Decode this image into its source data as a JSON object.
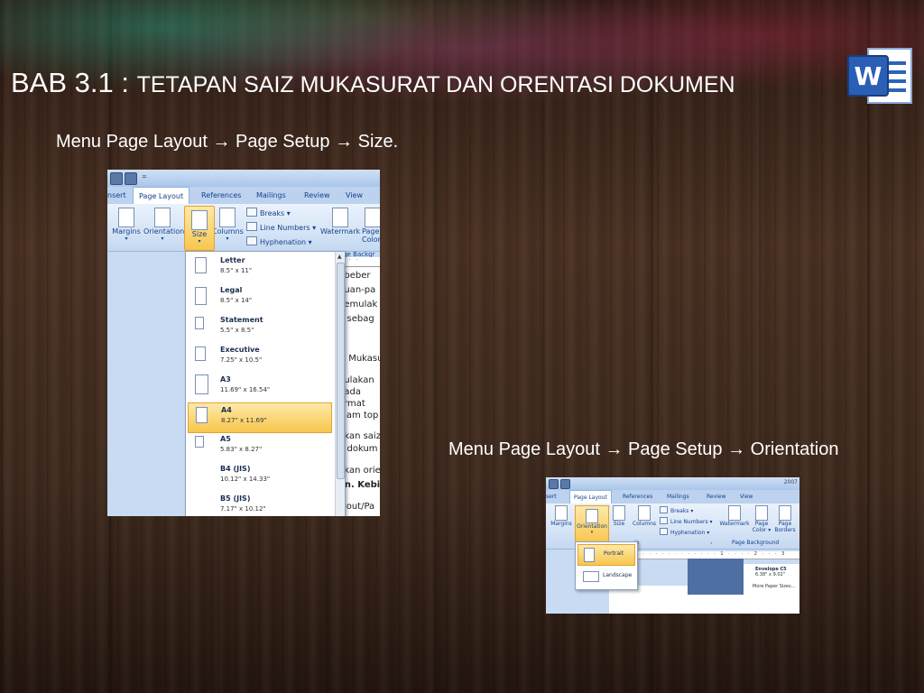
{
  "slide": {
    "title_prefix": "BAB 3.1 : ",
    "title_main": "TETAPAN SAIZ MUKASURAT DAN ORENTASI DOKUMEN",
    "caption1": "Menu Page Layout → Page Setup → Size.",
    "caption2": "Menu Page Layout → Page Setup → Orientation",
    "logo_letter": "W"
  },
  "size_screenshot": {
    "tabs": [
      "nsert",
      "Page Layout",
      "References",
      "Mailings",
      "Review",
      "View"
    ],
    "ribbon": {
      "margins": "Margins",
      "orientation": "Orientation",
      "size": "Size",
      "columns": "Columns",
      "breaks": "Breaks ▾",
      "line_numbers": "Line Numbers ▾",
      "hyphenation": "Hyphenation ▾",
      "watermark": "Watermark",
      "page_color": "Page Color",
      "page_background": "Page Backgr"
    },
    "sizes": [
      {
        "name": "Letter",
        "dim": "8.5\" x 11\""
      },
      {
        "name": "Legal",
        "dim": "8.5\" x 14\""
      },
      {
        "name": "Statement",
        "dim": "5.5\" x 8.5\""
      },
      {
        "name": "Executive",
        "dim": "7.25\" x 10.5\""
      },
      {
        "name": "A3",
        "dim": "11.69\" x 16.54\""
      },
      {
        "name": "A4",
        "dim": "8.27\" x 11.69\""
      },
      {
        "name": "A5",
        "dim": "5.83\" x 8.27\""
      },
      {
        "name": "B4 (JIS)",
        "dim": "10.12\" x 14.33\""
      },
      {
        "name": "B5 (JIS)",
        "dim": "7.17\" x 10.12\""
      }
    ],
    "selected_size": "A4",
    "doc_fragments": [
      ", beber",
      "duan-pa",
      "nemulak",
      "n sebag",
      "iz Mukasu",
      "nulakan",
      "nada",
      "ormat",
      "alam top",
      "ukan saiz",
      "n dokum",
      "ukan orie",
      "on. Kebi",
      "iyout/Pa"
    ]
  },
  "orientation_screenshot": {
    "tabs": [
      "sert",
      "Page Layout",
      "References",
      "Mailings",
      "Review",
      "View"
    ],
    "title_fragment": "2007",
    "ribbon": {
      "margins": "Margins",
      "orientation": "Orientation",
      "size": "Size",
      "columns": "Columns",
      "breaks": "Breaks ▾",
      "line_numbers": "Line Numbers ▾",
      "hyphenation": "Hyphenation ▾",
      "watermark": "Watermark",
      "page_color": "Page Color ▾",
      "page_borders": "Page Borders",
      "page_background": "Page Background",
      "setup_fragment": "ip"
    },
    "options": [
      "Portrait",
      "Landscape"
    ],
    "selected": "Portrait",
    "envelope_name": "Envelope C5",
    "envelope_dim": "6.38\" x 9.02\"",
    "more_sizes": "More Paper Sizes..."
  }
}
